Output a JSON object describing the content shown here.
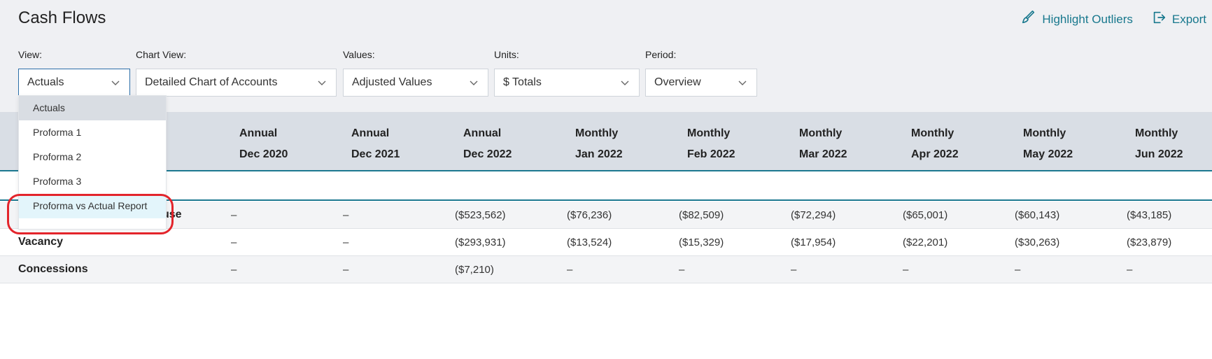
{
  "page": {
    "title": "Cash Flows"
  },
  "actions": {
    "highlight": "Highlight Outliers",
    "export": "Export"
  },
  "filters": {
    "view": {
      "label": "View:",
      "value": "Actuals"
    },
    "chart_view": {
      "label": "Chart View:",
      "value": "Detailed Chart of Accounts"
    },
    "values": {
      "label": "Values:",
      "value": "Adjusted Values"
    },
    "units": {
      "label": "Units:",
      "value": "$ Totals"
    },
    "period": {
      "label": "Period:",
      "value": "Overview"
    }
  },
  "dropdown": {
    "items": [
      "Actuals",
      "Proforma 1",
      "Proforma 2",
      "Proforma 3",
      "Proforma vs Actual Report"
    ],
    "selected": "Actuals",
    "highlighted": "Proforma vs Actual Report"
  },
  "table": {
    "columns": [
      {
        "line1": "Annual",
        "line2": "Dec 2020"
      },
      {
        "line1": "Annual",
        "line2": "Dec 2021"
      },
      {
        "line1": "Annual",
        "line2": "Dec 2022"
      },
      {
        "line1": "Monthly",
        "line2": "Jan 2022"
      },
      {
        "line1": "Monthly",
        "line2": "Feb 2022"
      },
      {
        "line1": "Monthly",
        "line2": "Mar 2022"
      },
      {
        "line1": "Monthly",
        "line2": "Apr 2022"
      },
      {
        "line1": "Monthly",
        "line2": "May 2022"
      },
      {
        "line1": "Monthly",
        "line2": "Jun 2022"
      }
    ],
    "rows": [
      {
        "name": "use",
        "values": [
          "–",
          "–",
          "($523,562)",
          "($76,236)",
          "($82,509)",
          "($72,294)",
          "($65,001)",
          "($60,143)",
          "($43,185)"
        ]
      },
      {
        "name": "Vacancy",
        "values": [
          "–",
          "–",
          "($293,931)",
          "($13,524)",
          "($15,329)",
          "($17,954)",
          "($22,201)",
          "($30,263)",
          "($23,879)"
        ]
      },
      {
        "name": "Concessions",
        "values": [
          "–",
          "–",
          "($7,210)",
          "–",
          "–",
          "–",
          "–",
          "–",
          "–"
        ]
      }
    ]
  },
  "colors": {
    "accent": "#18788d",
    "annotation": "#e3242b"
  }
}
